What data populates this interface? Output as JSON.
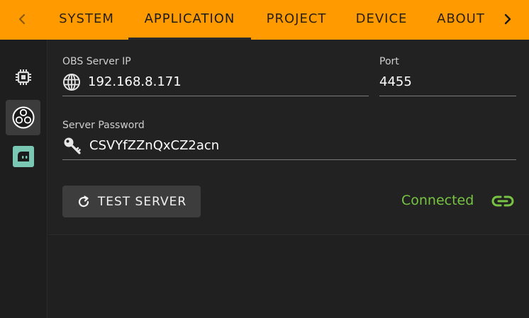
{
  "nav": {
    "tabs": [
      {
        "label": "SYSTEM"
      },
      {
        "label": "APPLICATION"
      },
      {
        "label": "PROJECT"
      },
      {
        "label": "DEVICE"
      },
      {
        "label": "ABOUT"
      }
    ],
    "active_tab": "APPLICATION",
    "prev_icon": "chevron-left-icon",
    "next_icon": "chevron-right-icon"
  },
  "sidebar": {
    "items": [
      {
        "icon": "chip-icon"
      },
      {
        "icon": "obs-icon"
      },
      {
        "icon": "streamlabs-icon"
      }
    ],
    "selected_index": 1
  },
  "obs": {
    "server_ip_label": "OBS Server IP",
    "server_ip": "192.168.8.171",
    "port_label": "Port",
    "port": "4455",
    "password_label": "Server Password",
    "password": "CSVYfZZnQxCZ2acn",
    "test_button_label": "TEST SERVER",
    "status": "Connected"
  },
  "colors": {
    "accent": "#ff9b00",
    "status_ok": "#76c442",
    "streamlabs": "#7ac8b4"
  }
}
